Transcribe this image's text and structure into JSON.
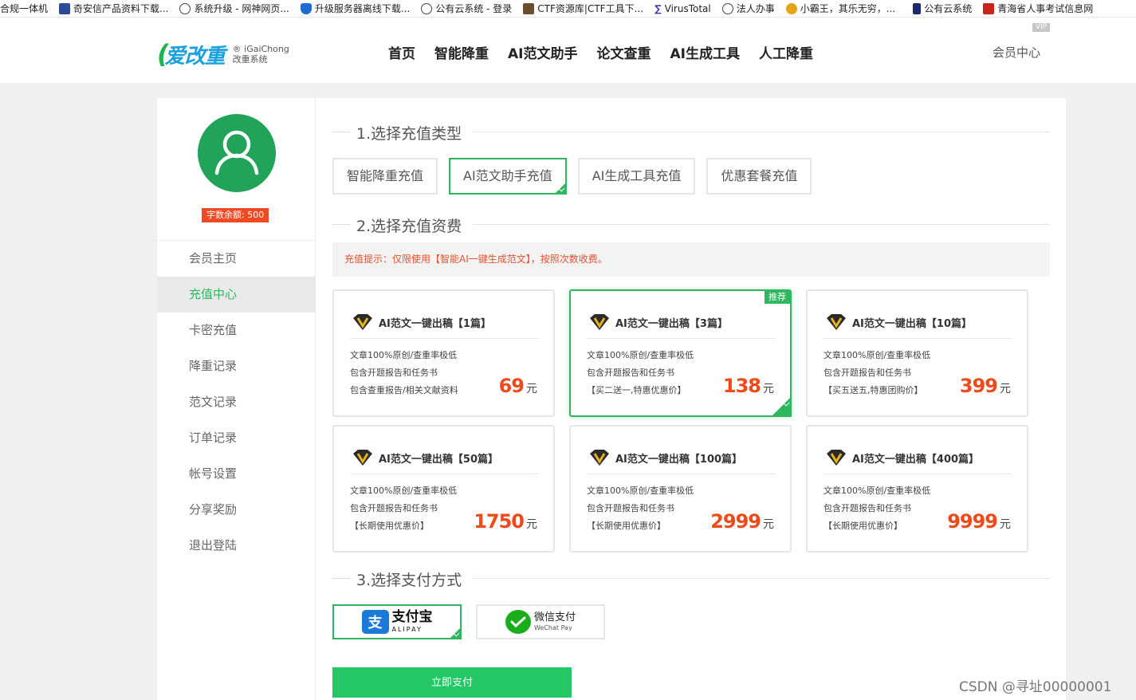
{
  "bookmarks": [
    "合规一体机",
    "奇安信产品资料下载...",
    "系统升级 - 网神网页...",
    "升级服务器离线下载...",
    "公有云系统 - 登录",
    "CTF资源库|CTF工具下...",
    "VirusTotal",
    "法人办事",
    "小霸王，其乐无穷，...",
    "公有云系统",
    "青海省人事考试信息网"
  ],
  "header": {
    "logo_text": "爱改重",
    "logo_sub1": "® iGaiChong",
    "logo_sub2": "改重系统",
    "nav": [
      "首页",
      "智能降重",
      "AI范文助手",
      "论文查重",
      "AI生成工具",
      "人工降重"
    ],
    "member": "会员中心",
    "vip_badge": "VIP"
  },
  "sidebar": {
    "balance": "字数余额: 500",
    "items": [
      "会员主页",
      "充值中心",
      "卡密充值",
      "降重记录",
      "范文记录",
      "订单记录",
      "帐号设置",
      "分享奖励",
      "退出登陆"
    ],
    "active_index": 1
  },
  "section1": {
    "title": "1.选择充值类型",
    "types": [
      "智能降重充值",
      "AI范文助手充值",
      "AI生成工具充值",
      "优惠套餐充值"
    ],
    "selected": 1
  },
  "section2": {
    "title": "2.选择充值资费",
    "tip": "充值提示：仅限使用【智能AI一键生成范文】，按照次数收费。",
    "recommend_label": "推荐",
    "unit": "元",
    "cards": [
      {
        "title": "AI范文一键出稿【1篇】",
        "f1": "文章100%原创/查重率极低",
        "f2": "包含开题报告和任务书",
        "f3": "包含查重报告/相关文献资料",
        "price": "69"
      },
      {
        "title": "AI范文一键出稿【3篇】",
        "f1": "文章100%原创/查重率极低",
        "f2": "包含开题报告和任务书",
        "f3": "【买二送一,特惠优惠价】",
        "price": "138"
      },
      {
        "title": "AI范文一键出稿【10篇】",
        "f1": "文章100%原创/查重率极低",
        "f2": "包含开题报告和任务书",
        "f3": "【买五送五,特惠团购价】",
        "price": "399"
      },
      {
        "title": "AI范文一键出稿【50篇】",
        "f1": "文章100%原创/查重率极低",
        "f2": "包含开题报告和任务书",
        "f3": "【长期使用优惠价】",
        "price": "1750"
      },
      {
        "title": "AI范文一键出稿【100篇】",
        "f1": "文章100%原创/查重率极低",
        "f2": "包含开题报告和任务书",
        "f3": "【长期使用优惠价】",
        "price": "2999"
      },
      {
        "title": "AI范文一键出稿【400篇】",
        "f1": "文章100%原创/查重率极低",
        "f2": "包含开题报告和任务书",
        "f3": "【长期使用优惠价】",
        "price": "9999"
      }
    ],
    "selected": 1
  },
  "section3": {
    "title": "3.选择支付方式",
    "alipay_cn": "支付宝",
    "alipay_en": "ALIPAY",
    "alipay_icon_char": "支",
    "wechat_cn": "微信支付",
    "wechat_en": "WeChat Pay",
    "pay_button": "立即支付"
  },
  "watermark": "CSDN @寻址00000001",
  "colors": {
    "accent": "#2fb760",
    "price": "#ee4a1a",
    "tip": "#e8502d",
    "button": "#23c864"
  }
}
